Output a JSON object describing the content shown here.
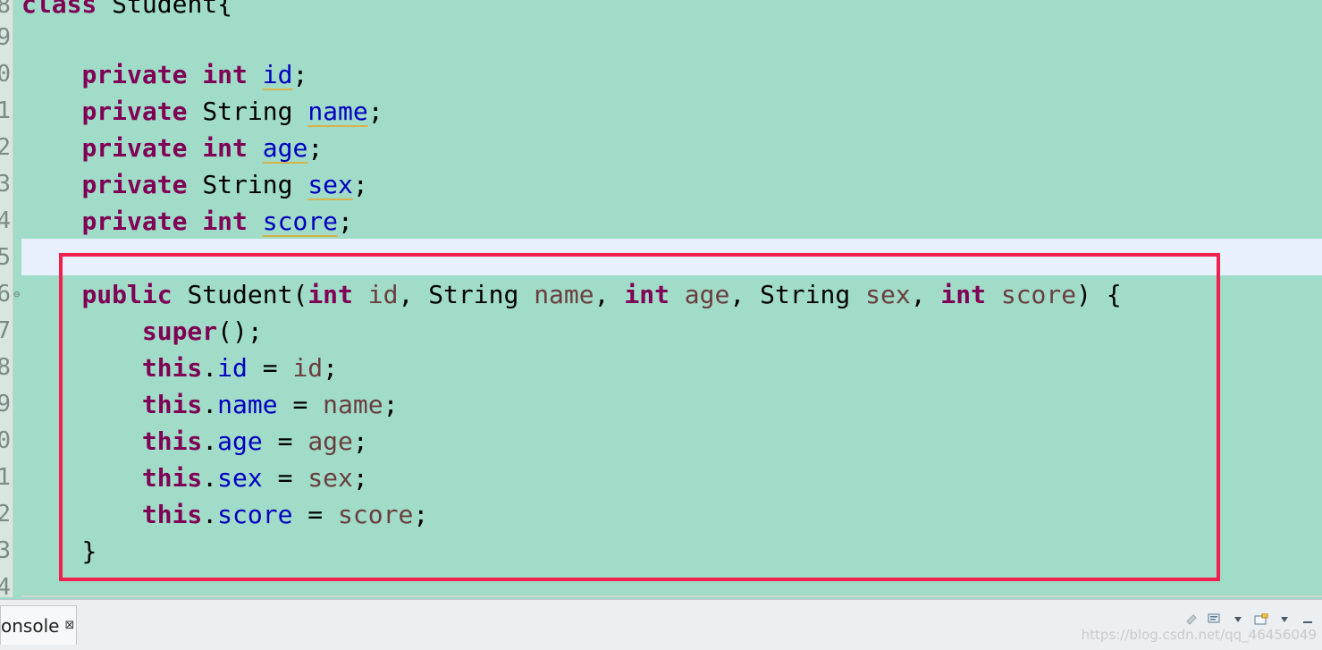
{
  "editor": {
    "line_numbers": [
      "8",
      "9",
      "0",
      "1",
      "2",
      "3",
      "4",
      "5",
      "6",
      "7",
      "8",
      "9",
      "0",
      "1",
      "2",
      "3",
      "4"
    ],
    "class_decl": {
      "kw": "class",
      "name": "Student{"
    },
    "fields": [
      {
        "mod": "private",
        "type": "int",
        "name": "id",
        "end": ";"
      },
      {
        "mod": "private",
        "type": "String",
        "name": "name",
        "end": ";"
      },
      {
        "mod": "private",
        "type": "int",
        "name": "age",
        "end": ";"
      },
      {
        "mod": "private",
        "type": "String",
        "name": "sex",
        "end": ";"
      },
      {
        "mod": "private",
        "type": "int",
        "name": "score",
        "end": ";"
      }
    ],
    "constructor": {
      "mod": "public",
      "name": "Student(",
      "params": [
        {
          "type": "int",
          "name": "id",
          "sep": ", "
        },
        {
          "type": "String",
          "name": "name",
          "sep": ", "
        },
        {
          "type": "int",
          "name": "age",
          "sep": ", "
        },
        {
          "type": "String",
          "name": "sex",
          "sep": ", "
        },
        {
          "type": "int",
          "name": "score",
          "sep": ") {"
        }
      ],
      "super_kw": "super",
      "super_rest": "();",
      "assignments": [
        {
          "this": "this",
          "dot": ".",
          "field": "id",
          "eq": " = ",
          "param": "id",
          "end": ";"
        },
        {
          "this": "this",
          "dot": ".",
          "field": "name",
          "eq": " = ",
          "param": "name",
          "end": ";"
        },
        {
          "this": "this",
          "dot": ".",
          "field": "age",
          "eq": " = ",
          "param": "age",
          "end": ";"
        },
        {
          "this": "this",
          "dot": ".",
          "field": "sex",
          "eq": " = ",
          "param": "sex",
          "end": ";"
        },
        {
          "this": "this",
          "dot": ".",
          "field": "score",
          "eq": " = ",
          "param": "score",
          "end": ";"
        }
      ],
      "close": "}"
    },
    "fold_marker": "⊖"
  },
  "bottom_panel": {
    "tab_label": "onsole",
    "tab_close": "⊠",
    "watermark": "https://blog.csdn.net/qq_46456049"
  },
  "colors": {
    "background": "#a0dcc7",
    "keyword": "#7f0055",
    "field": "#0000c0",
    "parameter": "#6a3e3e",
    "highlight_box": "#f0214d",
    "current_line": "#e8f0fe"
  }
}
